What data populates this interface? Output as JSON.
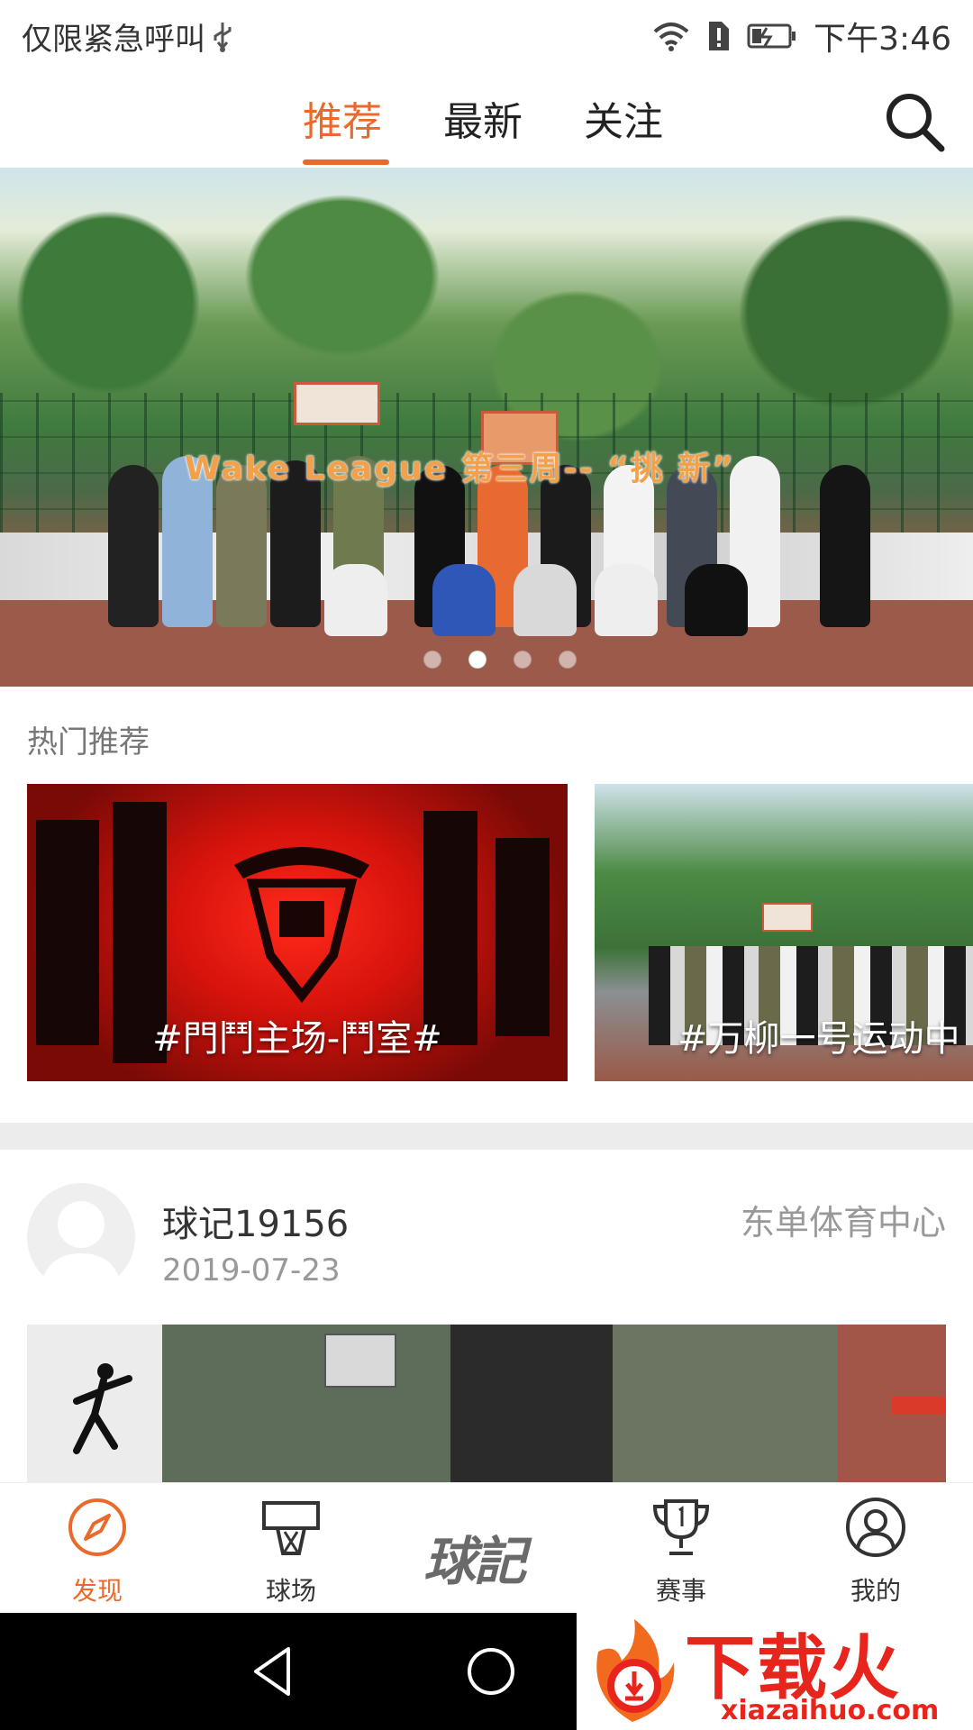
{
  "status_bar": {
    "carrier_text": "仅限紧急呼叫",
    "time": "下午3:46"
  },
  "top_tabs": {
    "tabs": [
      {
        "label": "推荐",
        "active": true
      },
      {
        "label": "最新",
        "active": false
      },
      {
        "label": "关注",
        "active": false
      }
    ],
    "accent_color": "#ea6a2c"
  },
  "banner": {
    "title": "Wake League 第三周-- “挑 新”",
    "dots_count": 4,
    "active_dot": 2
  },
  "hot": {
    "title": "热门推荐",
    "cards": [
      {
        "label": "#門鬥主场-鬥室#"
      },
      {
        "label": "#万柳一号运动中"
      }
    ]
  },
  "post": {
    "user": "球记19156",
    "date": "2019-07-23",
    "location": "东单体育中心"
  },
  "bottom_nav": {
    "items": [
      {
        "label": "发现",
        "active": true,
        "icon": "compass-icon"
      },
      {
        "label": "球场",
        "active": false,
        "icon": "hoop-icon"
      },
      {
        "label": "赛事",
        "active": false,
        "icon": "trophy-icon"
      },
      {
        "label": "我的",
        "active": false,
        "icon": "user-icon"
      }
    ],
    "center_logo": "球記"
  },
  "watermark": {
    "title": "下载火",
    "url": "xiazaihuo.com"
  }
}
